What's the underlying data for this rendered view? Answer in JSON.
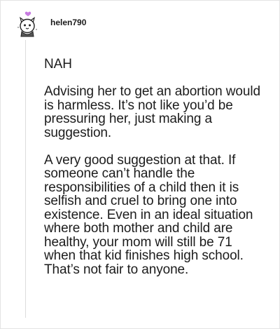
{
  "post": {
    "username": "helen790",
    "avatar_icon": "user-avatar-icon",
    "paragraphs": [
      "NAH",
      "Advising her to get an abortion would is harmless. It’s not like you’d be pressuring her, just making a suggestion.",
      "A very good suggestion at that. If someone can’t handle the responsibilities of a child then it is selfish and cruel to bring one into existence. Even in an ideal situation where both mother and child are healthy, your mom will still be 71 when that kid finishes high school. That’s not fair to anyone."
    ]
  },
  "colors": {
    "border": "#e4e4e4",
    "thread_line": "#dcdcdc",
    "text": "#1c1c1c",
    "heart": "#c77be0"
  }
}
